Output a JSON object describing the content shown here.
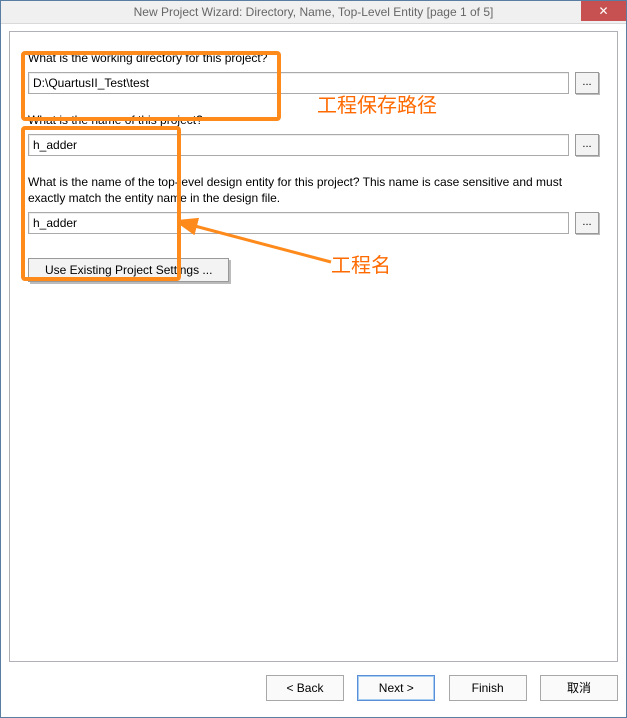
{
  "titlebar": {
    "title": "New Project Wizard: Directory, Name, Top-Level Entity [page 1 of 5]",
    "close_glyph": "✕"
  },
  "questions": {
    "working_dir": "What is the working directory for this project?",
    "project_name": "What is the name of this project?",
    "top_entity": "What is the name of the top-level design entity for this project? This name is case sensitive and must exactly match the entity name in the design file."
  },
  "fields": {
    "working_dir_value": "D:\\QuartusII_Test\\test",
    "project_name_value": "h_adder",
    "top_entity_value": "h_adder",
    "browse_label": "..."
  },
  "buttons": {
    "use_existing": "Use Existing Project Settings ...",
    "back": "< Back",
    "next": "Next >",
    "finish": "Finish",
    "cancel": "取消"
  },
  "annotations": {
    "save_path_label": "工程保存路径",
    "project_name_label": "工程名"
  }
}
